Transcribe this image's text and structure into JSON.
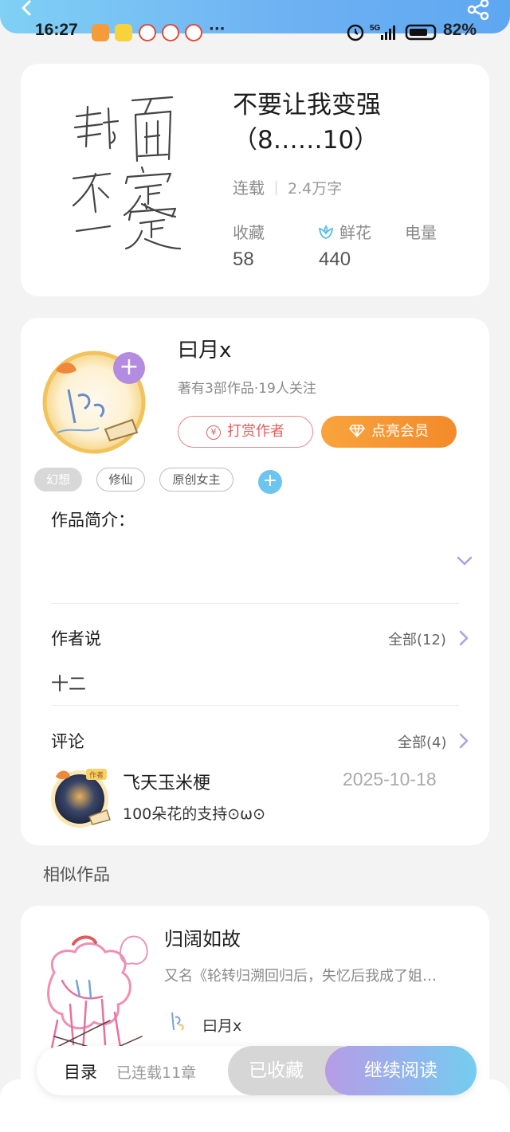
{
  "status_bar": {
    "time": "16:27",
    "more": "···",
    "network": "5G",
    "battery": "82%"
  },
  "book": {
    "cover_text": "封面不定一定",
    "title_line1": "不要让我变强",
    "title_line2": "（8……10）",
    "status": "连载",
    "words": "2.4万字",
    "stats": [
      {
        "label": "收藏",
        "value": "58"
      },
      {
        "label": "鲜花",
        "value": "440"
      },
      {
        "label": "电量",
        "value": ""
      }
    ]
  },
  "author": {
    "name": "曰月x",
    "meta": "著有3部作品·19人关注",
    "reward_label": "打赏作者",
    "reward_icon_glyph": "¥",
    "vip_label": "点亮会员",
    "follow_glyph": "+"
  },
  "tags": [
    "幻想",
    "修仙",
    "原创女主"
  ],
  "tag_add_glyph": "+",
  "intro": {
    "title": "作品简介："
  },
  "author_says": {
    "title": "作者说",
    "all_label": "全部(12)",
    "text": "十二"
  },
  "comments": {
    "title": "评论",
    "all_label": "全部(4)",
    "items": [
      {
        "user": "飞天玉米梗",
        "date": "2025-10-18",
        "text": "100朵花的支持⊙ω⊙",
        "badge": "作者"
      }
    ]
  },
  "similar": {
    "section_title": "相似作品",
    "items": [
      {
        "title": "归阔如故",
        "alias": "又名《轮转归溯回归后，失忆后我成了姐…",
        "author": "曰月x"
      }
    ]
  },
  "bottom_bar": {
    "toc": "目录",
    "chapters": "已连载11章",
    "collected": "已收藏",
    "continue": "继续阅读"
  },
  "colors": {
    "header_gradient_start": "#7fd0f5",
    "header_gradient_end": "#5ea7f1",
    "vip_orange": "#f48a2a",
    "reward_red": "#e06060",
    "plus_purple": "#b38be0",
    "tag_add_blue": "#6cc5ef"
  }
}
